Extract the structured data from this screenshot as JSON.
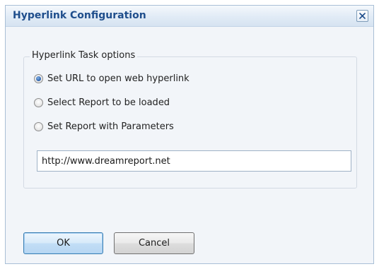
{
  "dialog": {
    "title": "Hyperlink Configuration",
    "close_icon": "close-icon"
  },
  "group": {
    "legend": "Hyperlink Task options",
    "options": [
      {
        "label": "Set URL to open web hyperlink",
        "checked": true
      },
      {
        "label": "Select Report to be loaded",
        "checked": false
      },
      {
        "label": "Set Report with Parameters",
        "checked": false
      }
    ]
  },
  "url": {
    "value": "http://www.dreamreport.net"
  },
  "buttons": {
    "ok": "OK",
    "cancel": "Cancel"
  },
  "colors": {
    "title_text": "#1f4e8c",
    "dialog_background": "#f2f5f9",
    "ok_border": "#3c7fb1"
  }
}
